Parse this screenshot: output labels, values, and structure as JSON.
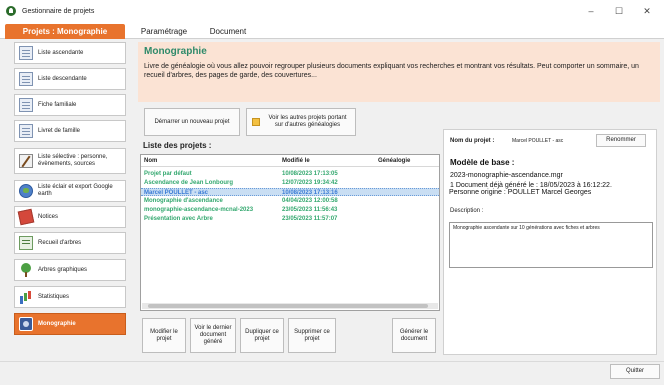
{
  "window": {
    "title": "Gestionnaire de projets",
    "controls": {
      "minimize": "–",
      "maximize": "☐",
      "close": "✕"
    }
  },
  "tabs": [
    {
      "label": "Projets : Monographie",
      "active": true
    },
    {
      "label": "Paramétrage",
      "active": false
    },
    {
      "label": "Document",
      "active": false
    }
  ],
  "sidebar": {
    "items": [
      {
        "label": "Liste ascendante",
        "icon": "document-list-icon"
      },
      {
        "label": "Liste descendante",
        "icon": "document-list-icon"
      },
      {
        "label": "Fiche familiale",
        "icon": "family-sheet-icon"
      },
      {
        "label": "Livret de famille",
        "icon": "family-book-icon"
      },
      {
        "label": "Liste sélective : personne, évènements, sources",
        "icon": "pen-icon"
      },
      {
        "label": "Liste éclair et export Google earth",
        "icon": "globe-icon"
      },
      {
        "label": "Notices",
        "icon": "notes-icon"
      },
      {
        "label": "Recueil d'arbres",
        "icon": "tree-collection-icon"
      },
      {
        "label": "Arbres graphiques",
        "icon": "tree-icon"
      },
      {
        "label": "Statistiques",
        "icon": "stats-icon"
      },
      {
        "label": "Monographie",
        "icon": "monograph-icon",
        "active": true
      }
    ]
  },
  "header": {
    "title": "Monographie",
    "description": "Livre de généalogie où vous allez pouvoir regrouper plusieurs documents expliquant vos recherches et montrant vos résultats. Peut comporter un sommaire, un recueil d'arbres, des pages de garde, des couvertures..."
  },
  "buttons": {
    "new_project": "Démarrer un nouveau projet",
    "other_projects": "Voir les autres projets portant sur d'autres généalogies",
    "modify": "Modifier le projet",
    "last_doc": "Voir le dernier document généré",
    "duplicate": "Dupliquer ce projet",
    "delete": "Supprimer ce projet",
    "generate": "Générer le document",
    "rename": "Renommer",
    "quit": "Quitter"
  },
  "project_list": {
    "title": "Liste des projets :",
    "columns": [
      "Nom",
      "Modifié le",
      "Généalogie"
    ],
    "rows": [
      {
        "name": "Projet par défaut",
        "modified": "10/08/2023 17:13:05",
        "genealogy": "",
        "selected": false
      },
      {
        "name": "Ascendance de Jean Lonbourg",
        "modified": "12/07/2023 19:34:42",
        "genealogy": "",
        "selected": false
      },
      {
        "name": "Marcel POULLET - asc",
        "modified": "10/08/2023 17:13:16",
        "genealogy": "",
        "selected": true
      },
      {
        "name": "Monographie d'ascendance",
        "modified": "04/04/2023 12:00:58",
        "genealogy": "",
        "selected": false
      },
      {
        "name": "monographie-ascendance-mcnal-2023",
        "modified": "23/05/2023 11:56:43",
        "genealogy": "",
        "selected": false
      },
      {
        "name": "Présentation avec Arbre",
        "modified": "23/05/2023 11:57:07",
        "genealogy": "",
        "selected": false
      }
    ]
  },
  "project_details": {
    "name_label": "Nom du projet :",
    "name_value": "Marcel POULLET - asc",
    "base_title": "Modèle de base :",
    "base_file": "2023-monographie-ascendance.mgr",
    "doc_generated": "1 Document déjà généré le : 18/05/2023 à 16:12:22.",
    "origin_person": "Personne origine : POULLET Marcel Georges",
    "description_label": "Description :",
    "description_value": "Monographie ascendante sur 10 générations avec fiches et arbres"
  }
}
